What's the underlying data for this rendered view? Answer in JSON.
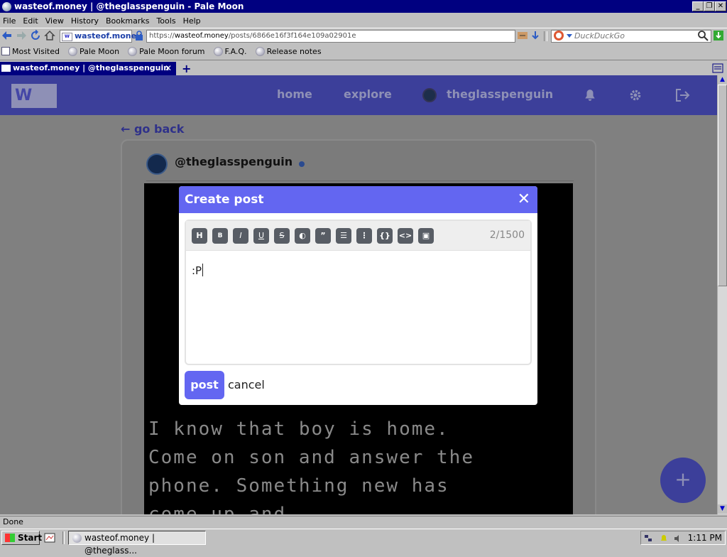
{
  "window": {
    "title": "wasteof.money | @theglasspenguin - Pale Moon"
  },
  "menu": [
    "File",
    "Edit",
    "View",
    "History",
    "Bookmarks",
    "Tools",
    "Help"
  ],
  "navbar": {
    "identity": "wasteof.money",
    "url_prefix": "https://",
    "url_host": "wasteof.money",
    "url_path": "/posts/6866e16f3f164e109a02901e",
    "search_placeholder": "DuckDuckGo"
  },
  "bookmarks": [
    "Most Visited",
    "Pale Moon",
    "Pale Moon forum",
    "F.A.Q.",
    "Release notes"
  ],
  "tabs": [
    {
      "label": "wasteof.money | @theglasspenguin",
      "close": "✕"
    }
  ],
  "newtab": "+",
  "site": {
    "logo": "W",
    "nav": {
      "home": "home",
      "explore": "explore",
      "user": "theglasspenguin"
    },
    "goback": "← go back",
    "post_user": "@theglasspenguin",
    "post_image_text": "I know that boy is home.\nCome on son and answer the\nphone. Something new has\ncome up and",
    "fab": "+"
  },
  "modal": {
    "title": "Create post",
    "close": "✕",
    "toolbar": [
      "H",
      "B",
      "I",
      "U",
      "S",
      "◐",
      "”",
      "☰",
      "⋮",
      "{}",
      "<>",
      "▣"
    ],
    "counter": "2/1500",
    "text": ":P",
    "post_label": "post",
    "cancel_label": "cancel"
  },
  "status": "Done",
  "taskbar": {
    "start": "Start",
    "task": "wasteof.money | @theglass...",
    "clock": "1:11 PM"
  },
  "colors": {
    "accent": "#6366f1",
    "header": "#3c3f9a",
    "titlebar": "#000080"
  }
}
